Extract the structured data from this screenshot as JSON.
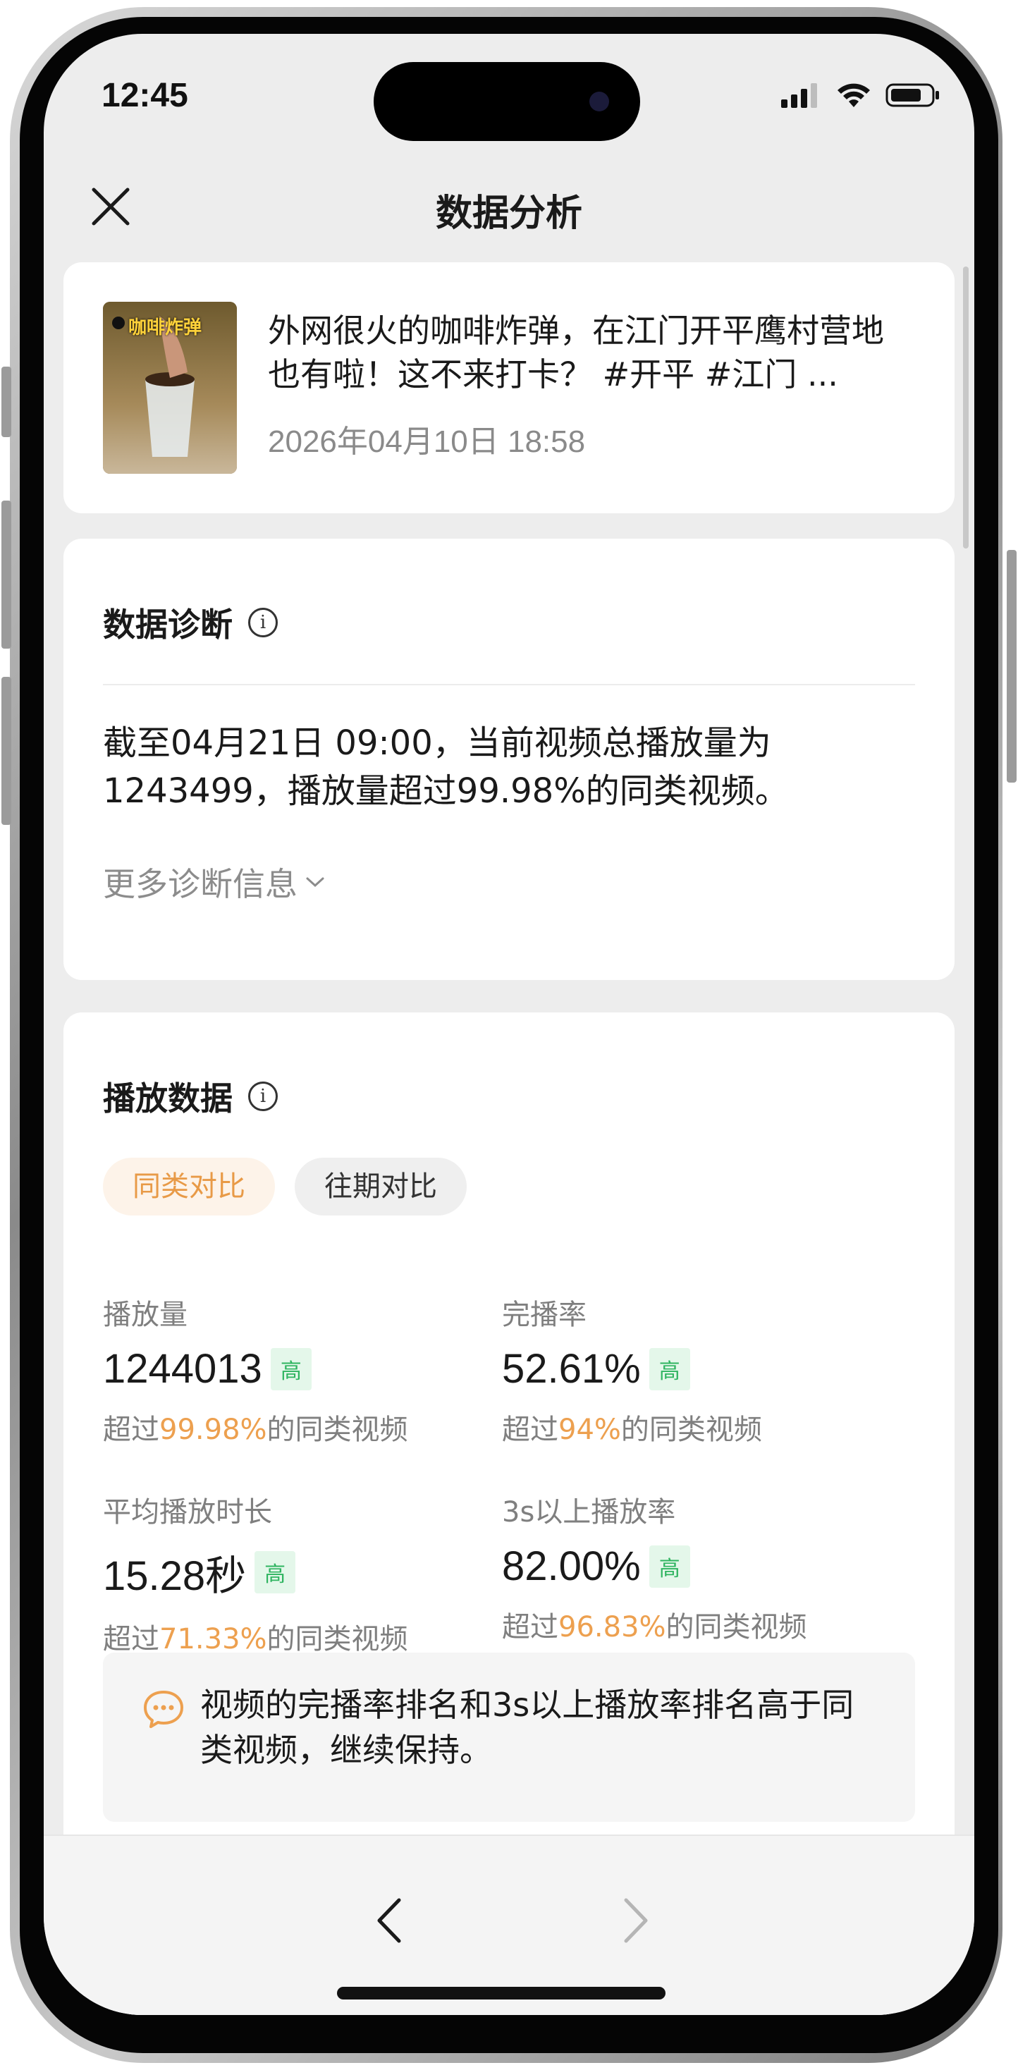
{
  "status_bar": {
    "time": "12:45"
  },
  "nav": {
    "title": "数据分析"
  },
  "video": {
    "thumbnail_text": "咖啡炸弹",
    "title": "外网很火的咖啡炸弹，在江门开平鹰村营地也有啦！这不来打卡？ #开平 #江门 ...",
    "published": "2026年04月10日 18:58"
  },
  "diagnosis": {
    "title": "数据诊断",
    "summary": "截至04月21日 09:00，当前视频总播放量为1243499，播放量超过99.98%的同类视频。",
    "more_label": "更多诊断信息"
  },
  "play_data": {
    "title": "播放数据",
    "tabs": [
      {
        "label": "同类对比",
        "active": true
      },
      {
        "label": "往期对比",
        "active": false
      }
    ],
    "metrics": [
      {
        "label": "播放量",
        "value": "1244013",
        "badge": "高",
        "sub_prefix": "超过",
        "sub_highlight": "99.98%",
        "sub_suffix": "的同类视频"
      },
      {
        "label": "完播率",
        "value": "52.61%",
        "badge": "高",
        "sub_prefix": "超过",
        "sub_highlight": "94%",
        "sub_suffix": "的同类视频"
      },
      {
        "label": "平均播放时长",
        "value": "15.28秒",
        "badge": "高",
        "sub_prefix": "超过",
        "sub_highlight": "71.33%",
        "sub_suffix": "的同类视频"
      },
      {
        "label": "3s以上播放率",
        "value": "82.00%",
        "badge": "高",
        "sub_prefix": "超过",
        "sub_highlight": "96.83%",
        "sub_suffix": "的同类视频"
      }
    ],
    "advice": "视频的完播率排名和3s以上播放率排名高于同类视频，继续保持。"
  },
  "colors": {
    "accent": "#eda04f",
    "badge_green": "#2fb460",
    "badge_bg": "#e4f7ea",
    "screen_bg": "#ededed"
  },
  "icons": {
    "close": "close-icon",
    "info": "info-icon",
    "chevron": "chevron-down-icon",
    "advice": "chat-bubble-icon",
    "prev": "chevron-left-icon",
    "next": "chevron-right-icon"
  }
}
